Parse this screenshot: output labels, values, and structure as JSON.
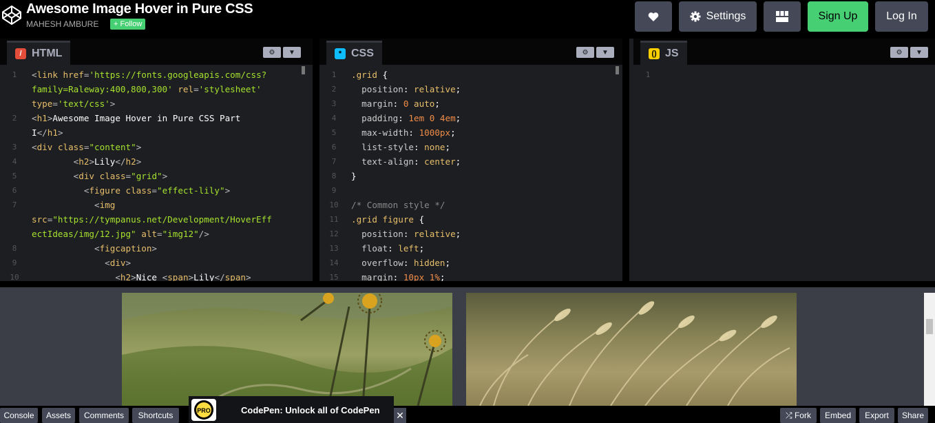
{
  "header": {
    "title": "Awesome Image Hover in Pure CSS",
    "author": "MAHESH AMBURE",
    "follow_label": "+ Follow",
    "settings_label": "Settings",
    "signup_label": "Sign Up",
    "login_label": "Log In"
  },
  "editors": {
    "html": {
      "label": "HTML",
      "lines": [
        {
          "n": "1",
          "segs": [
            [
              "tag",
              "<"
            ],
            [
              "tn",
              "link "
            ],
            [
              "an",
              "href"
            ],
            [
              "tag",
              "="
            ],
            [
              "av",
              "'https://fonts.googleapis.com/css?"
            ]
          ]
        },
        {
          "n": "",
          "segs": [
            [
              "av",
              "family=Raleway:400,800,300'"
            ],
            [
              "tag",
              " "
            ],
            [
              "an",
              "rel"
            ],
            [
              "tag",
              "="
            ],
            [
              "av",
              "'stylesheet'"
            ]
          ]
        },
        {
          "n": "",
          "segs": [
            [
              "an",
              "type"
            ],
            [
              "tag",
              "="
            ],
            [
              "av",
              "'text/css'"
            ],
            [
              "tag",
              ">"
            ]
          ]
        },
        {
          "n": "2",
          "segs": [
            [
              "tag",
              "<"
            ],
            [
              "tn",
              "h1"
            ],
            [
              "tag",
              ">"
            ],
            [
              "txt",
              "Awesome Image Hover in Pure CSS Part"
            ]
          ]
        },
        {
          "n": "",
          "segs": [
            [
              "txt",
              "I"
            ],
            [
              "tag",
              "</"
            ],
            [
              "tn",
              "h1"
            ],
            [
              "tag",
              ">"
            ]
          ]
        },
        {
          "n": "3",
          "segs": [
            [
              "tag",
              "<"
            ],
            [
              "tn",
              "div "
            ],
            [
              "an",
              "class"
            ],
            [
              "tag",
              "="
            ],
            [
              "av",
              "\"content\""
            ],
            [
              "tag",
              ">"
            ]
          ]
        },
        {
          "n": "4",
          "segs": [
            [
              "txt",
              "        "
            ],
            [
              "tag",
              "<"
            ],
            [
              "tn",
              "h2"
            ],
            [
              "tag",
              ">"
            ],
            [
              "txt",
              "Lily"
            ],
            [
              "tag",
              "</"
            ],
            [
              "tn",
              "h2"
            ],
            [
              "tag",
              ">"
            ]
          ]
        },
        {
          "n": "5",
          "segs": [
            [
              "txt",
              "        "
            ],
            [
              "tag",
              "<"
            ],
            [
              "tn",
              "div "
            ],
            [
              "an",
              "class"
            ],
            [
              "tag",
              "="
            ],
            [
              "av",
              "\"grid\""
            ],
            [
              "tag",
              ">"
            ]
          ]
        },
        {
          "n": "6",
          "segs": [
            [
              "txt",
              "          "
            ],
            [
              "tag",
              "<"
            ],
            [
              "tn",
              "figure "
            ],
            [
              "an",
              "class"
            ],
            [
              "tag",
              "="
            ],
            [
              "av",
              "\"effect-lily\""
            ],
            [
              "tag",
              ">"
            ]
          ]
        },
        {
          "n": "7",
          "segs": [
            [
              "txt",
              "            "
            ],
            [
              "tag",
              "<"
            ],
            [
              "tn",
              "img"
            ]
          ]
        },
        {
          "n": "",
          "segs": [
            [
              "an",
              "src"
            ],
            [
              "tag",
              "="
            ],
            [
              "av",
              "\"https://tympanus.net/Development/HoverEff"
            ]
          ]
        },
        {
          "n": "",
          "segs": [
            [
              "av",
              "ectIdeas/img/12.jpg\""
            ],
            [
              "tag",
              " "
            ],
            [
              "an",
              "alt"
            ],
            [
              "tag",
              "="
            ],
            [
              "av",
              "\"img12\""
            ],
            [
              "tag",
              "/>"
            ]
          ]
        },
        {
          "n": "8",
          "segs": [
            [
              "txt",
              "            "
            ],
            [
              "tag",
              "<"
            ],
            [
              "tn",
              "figcaption"
            ],
            [
              "tag",
              ">"
            ]
          ]
        },
        {
          "n": "9",
          "segs": [
            [
              "txt",
              "              "
            ],
            [
              "tag",
              "<"
            ],
            [
              "tn",
              "div"
            ],
            [
              "tag",
              ">"
            ]
          ]
        },
        {
          "n": "10",
          "segs": [
            [
              "txt",
              "                "
            ],
            [
              "tag",
              "<"
            ],
            [
              "tn",
              "h2"
            ],
            [
              "tag",
              ">"
            ],
            [
              "txt",
              "Nice "
            ],
            [
              "tag",
              "<"
            ],
            [
              "tn",
              "span"
            ],
            [
              "tag",
              ">"
            ],
            [
              "txt",
              "Lily"
            ],
            [
              "tag",
              "</"
            ],
            [
              "tn",
              "span"
            ],
            [
              "tag",
              ">"
            ]
          ]
        }
      ]
    },
    "css": {
      "label": "CSS",
      "lines": [
        {
          "n": "1",
          "segs": [
            [
              "sel",
              ".grid "
            ],
            [
              "txt",
              "{"
            ]
          ]
        },
        {
          "n": "2",
          "segs": [
            [
              "prop",
              "  position"
            ],
            [
              "txt",
              ": "
            ],
            [
              "sel",
              "relative"
            ],
            [
              "txt",
              ";"
            ]
          ]
        },
        {
          "n": "3",
          "segs": [
            [
              "prop",
              "  margin"
            ],
            [
              "txt",
              ": "
            ],
            [
              "num",
              "0"
            ],
            [
              "txt",
              " "
            ],
            [
              "sel",
              "auto"
            ],
            [
              "txt",
              ";"
            ]
          ]
        },
        {
          "n": "4",
          "segs": [
            [
              "prop",
              "  padding"
            ],
            [
              "txt",
              ": "
            ],
            [
              "num",
              "1em 0 4em"
            ],
            [
              "txt",
              ";"
            ]
          ]
        },
        {
          "n": "5",
          "segs": [
            [
              "prop",
              "  max-width"
            ],
            [
              "txt",
              ": "
            ],
            [
              "num",
              "1000px"
            ],
            [
              "txt",
              ";"
            ]
          ]
        },
        {
          "n": "6",
          "segs": [
            [
              "prop",
              "  list-style"
            ],
            [
              "txt",
              ": "
            ],
            [
              "sel",
              "none"
            ],
            [
              "txt",
              ";"
            ]
          ]
        },
        {
          "n": "7",
          "segs": [
            [
              "prop",
              "  text-align"
            ],
            [
              "txt",
              ": "
            ],
            [
              "sel",
              "center"
            ],
            [
              "txt",
              ";"
            ]
          ]
        },
        {
          "n": "8",
          "segs": [
            [
              "txt",
              "}"
            ]
          ]
        },
        {
          "n": "9",
          "segs": [
            [
              "txt",
              ""
            ]
          ]
        },
        {
          "n": "10",
          "segs": [
            [
              "cmt",
              "/* Common style */"
            ]
          ]
        },
        {
          "n": "11",
          "segs": [
            [
              "sel",
              ".grid figure "
            ],
            [
              "txt",
              "{"
            ]
          ]
        },
        {
          "n": "12",
          "segs": [
            [
              "prop",
              "  position"
            ],
            [
              "txt",
              ": "
            ],
            [
              "sel",
              "relative"
            ],
            [
              "txt",
              ";"
            ]
          ]
        },
        {
          "n": "13",
          "segs": [
            [
              "prop",
              "  float"
            ],
            [
              "txt",
              ": "
            ],
            [
              "sel",
              "left"
            ],
            [
              "txt",
              ";"
            ]
          ]
        },
        {
          "n": "14",
          "segs": [
            [
              "prop",
              "  overflow"
            ],
            [
              "txt",
              ": "
            ],
            [
              "sel",
              "hidden"
            ],
            [
              "txt",
              ";"
            ]
          ]
        },
        {
          "n": "15",
          "segs": [
            [
              "prop",
              "  margin"
            ],
            [
              "txt",
              ": "
            ],
            [
              "num",
              "10px 1%"
            ],
            [
              "txt",
              ";"
            ]
          ]
        }
      ]
    },
    "js": {
      "label": "JS",
      "lines": [
        {
          "n": "1",
          "segs": [
            [
              "txt",
              ""
            ]
          ]
        }
      ]
    }
  },
  "footer": {
    "console": "Console",
    "assets": "Assets",
    "comments": "Comments",
    "shortcuts": "Shortcuts",
    "promo_badge": "PRO",
    "promo_text": "CodePen: Unlock all of CodePen",
    "close": "✕",
    "fork": "⤮ Fork",
    "embed": "Embed",
    "export": "Export",
    "share": "Share"
  },
  "colors": {
    "accent_green": "#47cf73",
    "button_gray": "#444857",
    "editor_bg": "#1d1e22"
  }
}
